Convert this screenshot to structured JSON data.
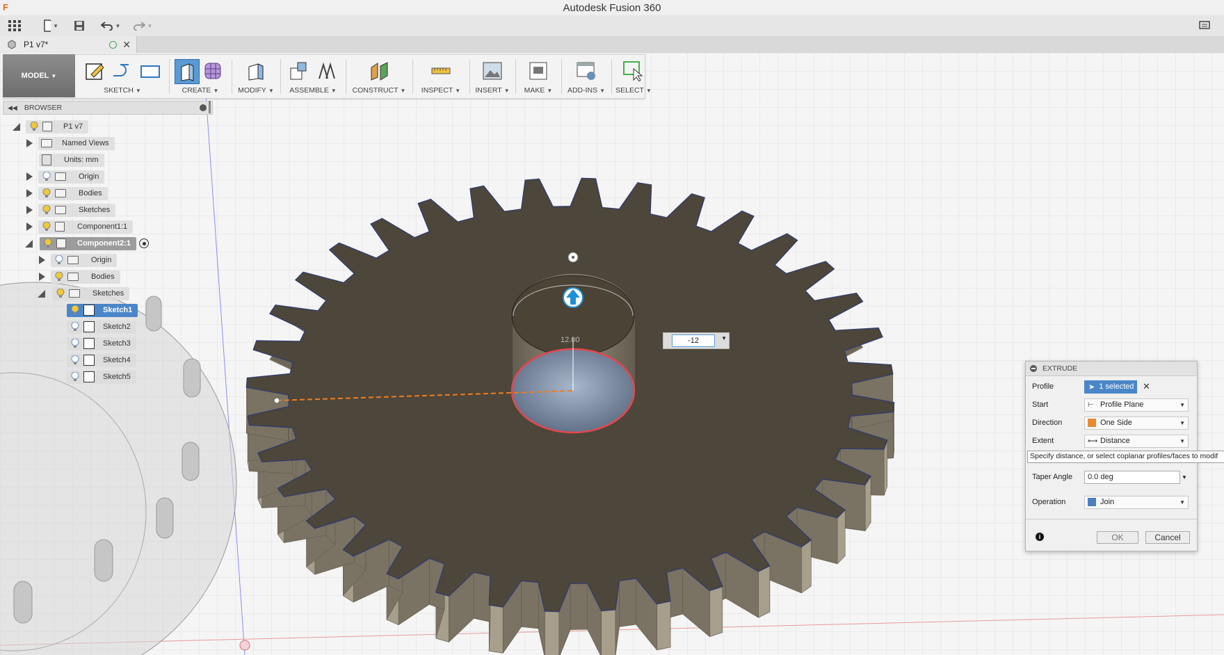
{
  "window": {
    "title": "Autodesk Fusion 360",
    "logo": "F"
  },
  "quick_access": {
    "grid_icon": "app-grid-icon",
    "file_icon": "file-icon",
    "save_icon": "save-icon",
    "undo_icon": "undo-icon",
    "redo_icon": "redo-icon",
    "comment_icon": "comment-icon"
  },
  "document_tab": {
    "name": "P1 v7*"
  },
  "toolbar": {
    "workspace": "MODEL",
    "groups": [
      "SKETCH",
      "CREATE",
      "MODIFY",
      "ASSEMBLE",
      "CONSTRUCT",
      "INSPECT",
      "INSERT",
      "MAKE",
      "ADD-INS",
      "SELECT"
    ]
  },
  "browser": {
    "title": "BROWSER",
    "items": [
      {
        "label": "P1 v7"
      },
      {
        "label": "Named Views"
      },
      {
        "label": "Units: mm"
      },
      {
        "label": "Origin"
      },
      {
        "label": "Bodies"
      },
      {
        "label": "Sketches"
      },
      {
        "label": "Component1:1"
      },
      {
        "label": "Component2:1"
      },
      {
        "label": "Origin"
      },
      {
        "label": "Bodies"
      },
      {
        "label": "Sketches"
      },
      {
        "label": "Sketch1"
      },
      {
        "label": "Sketch2"
      },
      {
        "label": "Sketch3"
      },
      {
        "label": "Sketch4"
      },
      {
        "label": "Sketch5"
      }
    ]
  },
  "viewport": {
    "distance_input": "-12",
    "ghost_dimension": "12.00"
  },
  "extrude": {
    "title": "EXTRUDE",
    "profile_label": "Profile",
    "profile_value": "1 selected",
    "start_label": "Start",
    "start_value": "Profile Plane",
    "direction_label": "Direction",
    "direction_value": "One Side",
    "extent_label": "Extent",
    "extent_value": "Distance",
    "tooltip": "Specify distance, or select coplanar profiles/faces to modif",
    "taper_label": "Taper Angle",
    "taper_value": "0.0 deg",
    "operation_label": "Operation",
    "operation_value": "Join",
    "ok_label": "OK",
    "cancel_label": "Cancel"
  }
}
